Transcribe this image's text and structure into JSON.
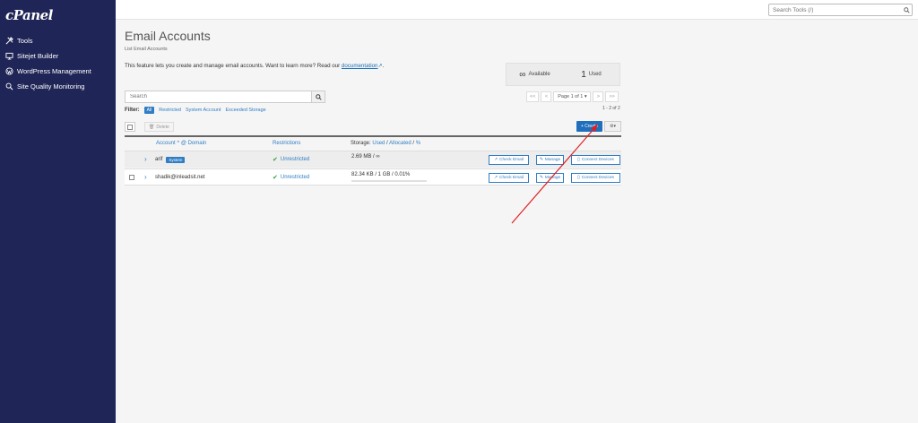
{
  "sidebar": {
    "logo": "cPanel",
    "items": [
      {
        "label": "Tools",
        "icon": "tools-icon"
      },
      {
        "label": "Sitejet Builder",
        "icon": "monitor-icon"
      },
      {
        "label": "WordPress Management",
        "icon": "wordpress-icon"
      },
      {
        "label": "Site Quality Monitoring",
        "icon": "magnifier-icon"
      }
    ]
  },
  "topbar": {
    "search_placeholder": "Search Tools (/)"
  },
  "page": {
    "title": "Email Accounts",
    "subtitle": "List Email Accounts",
    "description": "This feature lets you create and manage email accounts. Want to learn more? Read our ",
    "doc_link": "documentation",
    "desc_end": "."
  },
  "stats": {
    "available_symbol": "∞",
    "available_label": "Available",
    "used_count": "1",
    "used_label": "Used"
  },
  "search": {
    "placeholder": "Search"
  },
  "pager": {
    "first": "<<",
    "prev": "<",
    "page_label": "Page 1 of 1 ▾",
    "next": ">",
    "last": ">>",
    "count": "1 - 2 of 2"
  },
  "filter": {
    "label": "Filter:",
    "all": "All",
    "restricted": "Restricted",
    "system": "System Account",
    "exceeded": "Exceeded Storage"
  },
  "toolbar": {
    "delete": "Delete",
    "create": "+ Create",
    "gear": "⚙▾"
  },
  "table": {
    "col_account": "Account ^ @ Domain",
    "col_restrictions": "Restrictions",
    "col_storage_prefix": "Storage: ",
    "col_storage_used": "Used",
    "col_storage_sep": " / ",
    "col_storage_alloc": "Allocated",
    "col_storage_sep2": " / ",
    "col_storage_pct": "%",
    "rows": [
      {
        "account": "arif",
        "badge": "System",
        "restriction": "Unrestricted",
        "storage": "2.69 MB / ∞",
        "check": "Check Email",
        "manage": "Manage",
        "devices": "Connect Devices"
      },
      {
        "account": "shadik@inleadsit.net",
        "restriction": "Unrestricted",
        "storage": "82.34 KB / 1 GB / 0.01%",
        "check": "Check Email",
        "manage": "Manage",
        "devices": "Connect Devices"
      }
    ]
  },
  "colors": {
    "sidebar": "#1f2557",
    "accent": "#2f7dc4",
    "create": "#1f6fbd",
    "annotation_arrow": "#e02020"
  }
}
